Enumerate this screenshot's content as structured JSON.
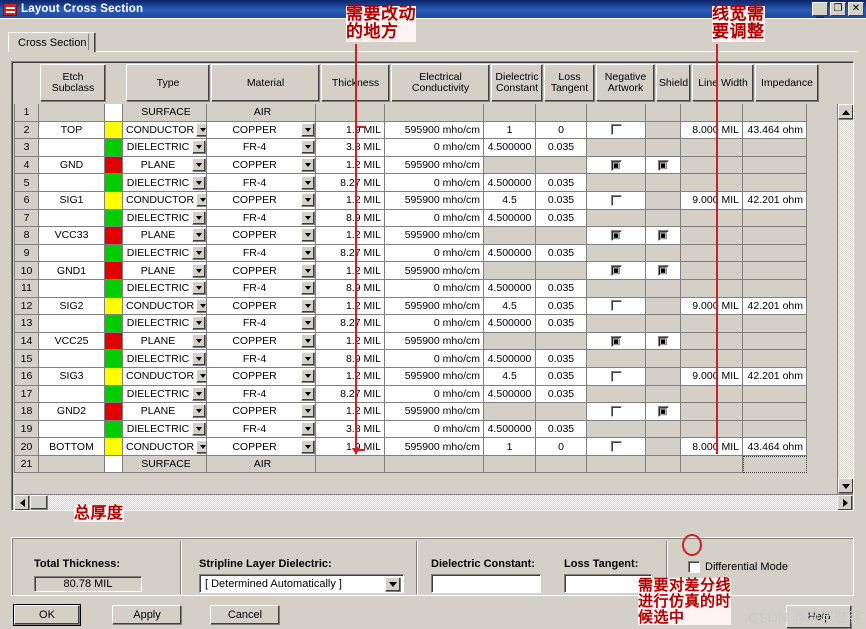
{
  "window": {
    "title": "Layout Cross Section",
    "minimize_label": "_",
    "maximize_label": "❐",
    "close_label": "✕"
  },
  "tabs": [
    {
      "label": "Cross Section"
    }
  ],
  "grid": {
    "headers": [
      "",
      "Etch\nSubclass",
      "",
      "Type",
      "Material",
      "Thickness",
      "Electrical\nConductivity",
      "Dielectric\nConstant",
      "Loss\nTangent",
      "Negative\nArtwork",
      "Shield",
      "Line Width",
      "Impedance"
    ],
    "headers_flat": [
      "",
      "Etch Subclass",
      "",
      "Type",
      "Material",
      "Thickness",
      "Electrical Conductivity",
      "Dielectric Constant",
      "Loss Tangent",
      "Negative Artwork",
      "Shield",
      "Line Width",
      "Impedance"
    ],
    "rows": [
      {
        "n": "1",
        "subclass": "",
        "color": "#ffffff",
        "type": "SURFACE",
        "combo": false,
        "material": "AIR",
        "thickness": "",
        "conductivity": "",
        "dk": "",
        "loss": "",
        "neg": "",
        "shield": "",
        "linewidth": "",
        "impedance": ""
      },
      {
        "n": "2",
        "subclass": "TOP",
        "color": "#ffff00",
        "type": "CONDUCTOR",
        "combo": true,
        "material": "COPPER",
        "thickness": "1.9 MIL",
        "conductivity": "595900 mho/cm",
        "dk": "1",
        "loss": "0",
        "neg": "off",
        "shield": "",
        "linewidth": "8.000 MIL",
        "impedance": "43.464 ohm"
      },
      {
        "n": "3",
        "subclass": "",
        "color": "#00cc00",
        "type": "DIELECTRIC",
        "combo": true,
        "material": "FR-4",
        "thickness": "3.8 MIL",
        "conductivity": "0 mho/cm",
        "dk": "4.500000",
        "loss": "0.035",
        "neg": "",
        "shield": "",
        "linewidth": "",
        "impedance": ""
      },
      {
        "n": "4",
        "subclass": "GND",
        "color": "#e00000",
        "type": "PLANE",
        "combo": true,
        "material": "COPPER",
        "thickness": "1.2 MIL",
        "conductivity": "595900 mho/cm",
        "dk": "",
        "loss": "",
        "neg": "on",
        "shield": "on",
        "linewidth": "",
        "impedance": ""
      },
      {
        "n": "5",
        "subclass": "",
        "color": "#00cc00",
        "type": "DIELECTRIC",
        "combo": true,
        "material": "FR-4",
        "thickness": "8.27 MIL",
        "conductivity": "0 mho/cm",
        "dk": "4.500000",
        "loss": "0.035",
        "neg": "",
        "shield": "",
        "linewidth": "",
        "impedance": ""
      },
      {
        "n": "6",
        "subclass": "SIG1",
        "color": "#ffff00",
        "type": "CONDUCTOR",
        "combo": true,
        "material": "COPPER",
        "thickness": "1.2 MIL",
        "conductivity": "595900 mho/cm",
        "dk": "4.5",
        "loss": "0.035",
        "neg": "off",
        "shield": "",
        "linewidth": "9.000 MIL",
        "impedance": "42.201 ohm"
      },
      {
        "n": "7",
        "subclass": "",
        "color": "#00cc00",
        "type": "DIELECTRIC",
        "combo": true,
        "material": "FR-4",
        "thickness": "8.9 MIL",
        "conductivity": "0 mho/cm",
        "dk": "4.500000",
        "loss": "0.035",
        "neg": "",
        "shield": "",
        "linewidth": "",
        "impedance": ""
      },
      {
        "n": "8",
        "subclass": "VCC33",
        "color": "#e00000",
        "type": "PLANE",
        "combo": true,
        "material": "COPPER",
        "thickness": "1.2 MIL",
        "conductivity": "595900 mho/cm",
        "dk": "",
        "loss": "",
        "neg": "on",
        "shield": "on",
        "linewidth": "",
        "impedance": ""
      },
      {
        "n": "9",
        "subclass": "",
        "color": "#00cc00",
        "type": "DIELECTRIC",
        "combo": true,
        "material": "FR-4",
        "thickness": "8.27 MIL",
        "conductivity": "0 mho/cm",
        "dk": "4.500000",
        "loss": "0.035",
        "neg": "",
        "shield": "",
        "linewidth": "",
        "impedance": ""
      },
      {
        "n": "10",
        "subclass": "GND1",
        "color": "#e00000",
        "type": "PLANE",
        "combo": true,
        "material": "COPPER",
        "thickness": "1.2 MIL",
        "conductivity": "595900 mho/cm",
        "dk": "",
        "loss": "",
        "neg": "on",
        "shield": "on",
        "linewidth": "",
        "impedance": ""
      },
      {
        "n": "11",
        "subclass": "",
        "color": "#00cc00",
        "type": "DIELECTRIC",
        "combo": true,
        "material": "FR-4",
        "thickness": "8.9 MIL",
        "conductivity": "0 mho/cm",
        "dk": "4.500000",
        "loss": "0.035",
        "neg": "",
        "shield": "",
        "linewidth": "",
        "impedance": ""
      },
      {
        "n": "12",
        "subclass": "SIG2",
        "color": "#ffff00",
        "type": "CONDUCTOR",
        "combo": true,
        "material": "COPPER",
        "thickness": "1.2 MIL",
        "conductivity": "595900 mho/cm",
        "dk": "4.5",
        "loss": "0.035",
        "neg": "off",
        "shield": "",
        "linewidth": "9.000 MIL",
        "impedance": "42.201 ohm"
      },
      {
        "n": "13",
        "subclass": "",
        "color": "#00cc00",
        "type": "DIELECTRIC",
        "combo": true,
        "material": "FR-4",
        "thickness": "8.27 MIL",
        "conductivity": "0 mho/cm",
        "dk": "4.500000",
        "loss": "0.035",
        "neg": "",
        "shield": "",
        "linewidth": "",
        "impedance": ""
      },
      {
        "n": "14",
        "subclass": "VCC25",
        "color": "#e00000",
        "type": "PLANE",
        "combo": true,
        "material": "COPPER",
        "thickness": "1.2 MIL",
        "conductivity": "595900 mho/cm",
        "dk": "",
        "loss": "",
        "neg": "on",
        "shield": "on",
        "linewidth": "",
        "impedance": ""
      },
      {
        "n": "15",
        "subclass": "",
        "color": "#00cc00",
        "type": "DIELECTRIC",
        "combo": true,
        "material": "FR-4",
        "thickness": "8.9 MIL",
        "conductivity": "0 mho/cm",
        "dk": "4.500000",
        "loss": "0.035",
        "neg": "",
        "shield": "",
        "linewidth": "",
        "impedance": ""
      },
      {
        "n": "16",
        "subclass": "SIG3",
        "color": "#ffff00",
        "type": "CONDUCTOR",
        "combo": true,
        "material": "COPPER",
        "thickness": "1.2 MIL",
        "conductivity": "595900 mho/cm",
        "dk": "4.5",
        "loss": "0.035",
        "neg": "off",
        "shield": "",
        "linewidth": "9.000 MIL",
        "impedance": "42.201 ohm"
      },
      {
        "n": "17",
        "subclass": "",
        "color": "#00cc00",
        "type": "DIELECTRIC",
        "combo": true,
        "material": "FR-4",
        "thickness": "8.27 MIL",
        "conductivity": "0 mho/cm",
        "dk": "4.500000",
        "loss": "0.035",
        "neg": "",
        "shield": "",
        "linewidth": "",
        "impedance": ""
      },
      {
        "n": "18",
        "subclass": "GND2",
        "color": "#e00000",
        "type": "PLANE",
        "combo": true,
        "material": "COPPER",
        "thickness": "1.2 MIL",
        "conductivity": "595900 mho/cm",
        "dk": "",
        "loss": "",
        "neg": "off",
        "shield": "on",
        "linewidth": "",
        "impedance": ""
      },
      {
        "n": "19",
        "subclass": "",
        "color": "#00cc00",
        "type": "DIELECTRIC",
        "combo": true,
        "material": "FR-4",
        "thickness": "3.8 MIL",
        "conductivity": "0 mho/cm",
        "dk": "4.500000",
        "loss": "0.035",
        "neg": "",
        "shield": "",
        "linewidth": "",
        "impedance": ""
      },
      {
        "n": "20",
        "subclass": "BOTTOM",
        "color": "#ffff00",
        "type": "CONDUCTOR",
        "combo": true,
        "material": "COPPER",
        "thickness": "1.9 MIL",
        "conductivity": "595900 mho/cm",
        "dk": "1",
        "loss": "0",
        "neg": "off",
        "shield": "",
        "linewidth": "8.000 MIL",
        "impedance": "43.464 ohm"
      },
      {
        "n": "21",
        "subclass": "",
        "color": "#ffffff",
        "type": "SURFACE",
        "combo": false,
        "material": "AIR",
        "thickness": "",
        "conductivity": "",
        "dk": "",
        "loss": "",
        "neg": "",
        "shield": "",
        "linewidth": "",
        "impedance": ""
      }
    ],
    "checkbox_on_glyph": "▣",
    "checkbox_off_glyph": ""
  },
  "bottom": {
    "total_thickness_label": "Total Thickness:",
    "total_thickness_value": "80.78 MIL",
    "stripline_label": "Stripline Layer Dielectric:",
    "stripline_value": "[  Determined Automatically  ]",
    "dielectric_constant_label": "Dielectric Constant:",
    "dielectric_constant_value": "",
    "loss_tangent_label": "Loss Tangent:",
    "loss_tangent_value": "",
    "differential_mode_label": "Differential Mode",
    "differential_mode_checked": false
  },
  "buttons": {
    "ok": "OK",
    "apply": "Apply",
    "cancel": "Cancel",
    "help": "Help"
  },
  "annotations": {
    "thickness_note": "需要改动\n的地方",
    "linewidth_note": "线宽需\n要调整",
    "total_thickness_note": "总厚度",
    "differential_note": "需要对差分线\n进行仿真的时\n候选中"
  },
  "watermark": "CSDN @流年过客",
  "colors": {
    "annotation_red": "#b00000",
    "line_red": "#cc2222",
    "window_face": "#d4d0c8",
    "title_blue": "#0a246a"
  }
}
